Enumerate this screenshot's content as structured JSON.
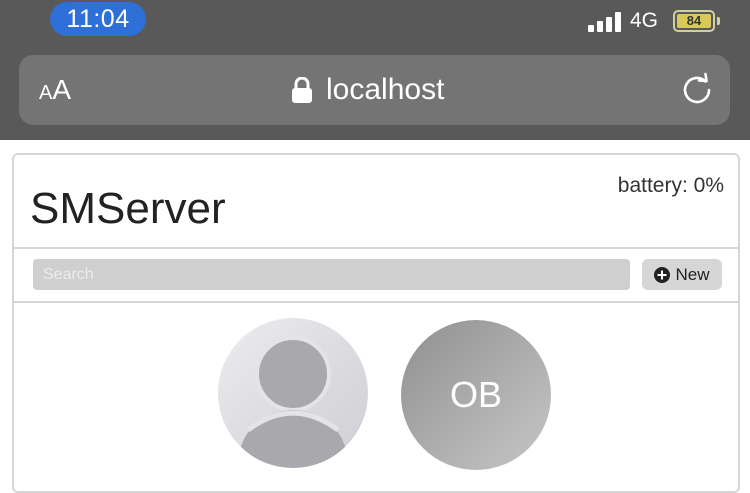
{
  "status_bar": {
    "time": "11:04",
    "network": "4G",
    "battery_level": "84"
  },
  "address_bar": {
    "text_size_small": "A",
    "text_size_large": "A",
    "url": "localhost"
  },
  "app": {
    "title": "SMServer",
    "battery_status": "battery: 0%",
    "search_placeholder": "Search",
    "new_button_label": "New",
    "contacts": [
      {
        "initials": ""
      },
      {
        "initials": "OB"
      }
    ]
  },
  "colors": {
    "time_pill": "#2f6fd8",
    "chrome_background": "#595959",
    "address_bar": "#747474"
  },
  "icons": [
    "lock-icon",
    "reload-icon",
    "plus-circle-icon",
    "default-person-icon"
  ]
}
